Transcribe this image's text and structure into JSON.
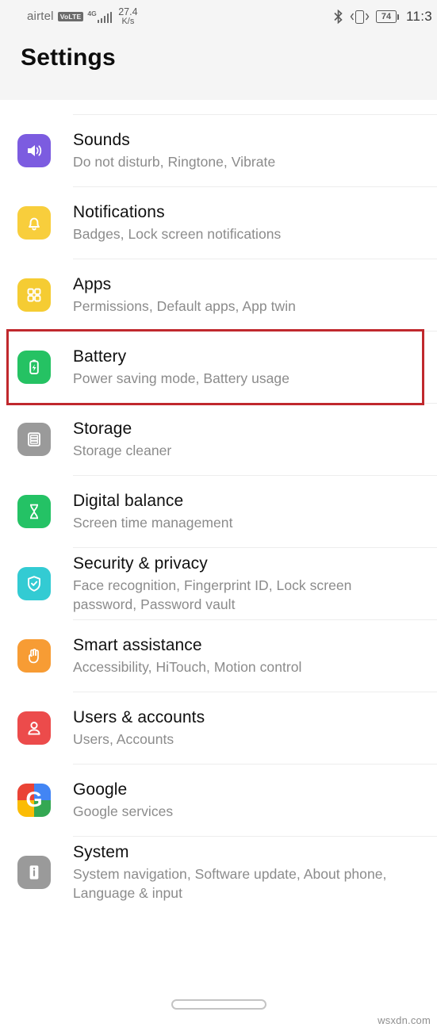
{
  "status_bar": {
    "carrier": "airtel",
    "volte_badge": "VoLTE",
    "network_type": "4G",
    "data_speed_value": "27.4",
    "data_speed_unit": "K/s",
    "bluetooth_icon": "bluetooth-icon",
    "vibrate_icon": "vibrate-icon",
    "battery_level": "74",
    "time": "11:3"
  },
  "header": {
    "title": "Settings"
  },
  "settings_list": [
    {
      "title": "Sounds",
      "subtitle": "Do not disturb, Ringtone, Vibrate",
      "icon": "speaker-icon",
      "icon_color": "#7C5CE0",
      "highlighted": false
    },
    {
      "title": "Notifications",
      "subtitle": "Badges, Lock screen notifications",
      "icon": "bell-icon",
      "icon_color": "#F8CE3C",
      "highlighted": false
    },
    {
      "title": "Apps",
      "subtitle": "Permissions, Default apps, App twin",
      "icon": "apps-grid-icon",
      "icon_color": "#F5CC33",
      "highlighted": false
    },
    {
      "title": "Battery",
      "subtitle": "Power saving mode, Battery usage",
      "icon": "battery-bolt-icon",
      "icon_color": "#25C263",
      "highlighted": true
    },
    {
      "title": "Storage",
      "subtitle": "Storage cleaner",
      "icon": "storage-list-icon",
      "icon_color": "#9A9A9A",
      "highlighted": false
    },
    {
      "title": "Digital balance",
      "subtitle": "Screen time management",
      "icon": "hourglass-icon",
      "icon_color": "#24C265",
      "highlighted": false
    },
    {
      "title": "Security & privacy",
      "subtitle": "Face recognition, Fingerprint ID, Lock screen password, Password vault",
      "icon": "shield-check-icon",
      "icon_color": "#33CBD3",
      "highlighted": false
    },
    {
      "title": "Smart assistance",
      "subtitle": "Accessibility, HiTouch, Motion control",
      "icon": "hand-icon",
      "icon_color": "#F79C34",
      "highlighted": false
    },
    {
      "title": "Users & accounts",
      "subtitle": "Users, Accounts",
      "icon": "person-icon",
      "icon_color": "#EC4B4B",
      "highlighted": false
    },
    {
      "title": "Google",
      "subtitle": "Google services",
      "icon": "google-g-icon",
      "icon_color": "#4285F4",
      "icon_letter": "G",
      "highlighted": false
    },
    {
      "title": "System",
      "subtitle": "System navigation, Software update, About phone, Language & input",
      "icon": "phone-info-icon",
      "icon_color": "#9A9A9A",
      "highlighted": false
    }
  ],
  "annotation": {
    "type": "red-rectangle",
    "color": "#c0282d",
    "target": "Battery"
  },
  "navigation_bar": {
    "gesture_pill": "home-gesture-pill"
  },
  "watermark": {
    "text": "wsxdn.com"
  }
}
